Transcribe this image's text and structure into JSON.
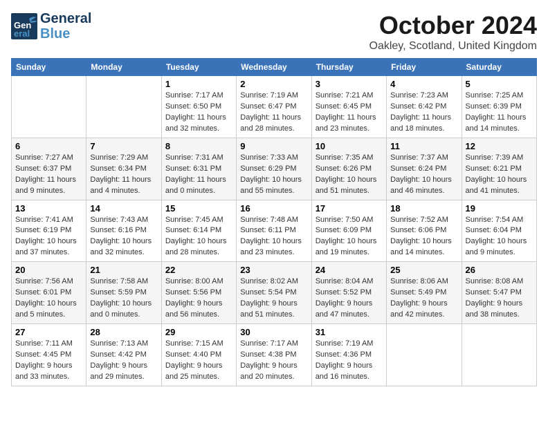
{
  "logo": {
    "line1": "General",
    "line2": "Blue"
  },
  "title": "October 2024",
  "subtitle": "Oakley, Scotland, United Kingdom",
  "days_of_week": [
    "Sunday",
    "Monday",
    "Tuesday",
    "Wednesday",
    "Thursday",
    "Friday",
    "Saturday"
  ],
  "weeks": [
    [
      {
        "day": "",
        "info": ""
      },
      {
        "day": "",
        "info": ""
      },
      {
        "day": "1",
        "info": "Sunrise: 7:17 AM\nSunset: 6:50 PM\nDaylight: 11 hours and 32 minutes."
      },
      {
        "day": "2",
        "info": "Sunrise: 7:19 AM\nSunset: 6:47 PM\nDaylight: 11 hours and 28 minutes."
      },
      {
        "day": "3",
        "info": "Sunrise: 7:21 AM\nSunset: 6:45 PM\nDaylight: 11 hours and 23 minutes."
      },
      {
        "day": "4",
        "info": "Sunrise: 7:23 AM\nSunset: 6:42 PM\nDaylight: 11 hours and 18 minutes."
      },
      {
        "day": "5",
        "info": "Sunrise: 7:25 AM\nSunset: 6:39 PM\nDaylight: 11 hours and 14 minutes."
      }
    ],
    [
      {
        "day": "6",
        "info": "Sunrise: 7:27 AM\nSunset: 6:37 PM\nDaylight: 11 hours and 9 minutes."
      },
      {
        "day": "7",
        "info": "Sunrise: 7:29 AM\nSunset: 6:34 PM\nDaylight: 11 hours and 4 minutes."
      },
      {
        "day": "8",
        "info": "Sunrise: 7:31 AM\nSunset: 6:31 PM\nDaylight: 11 hours and 0 minutes."
      },
      {
        "day": "9",
        "info": "Sunrise: 7:33 AM\nSunset: 6:29 PM\nDaylight: 10 hours and 55 minutes."
      },
      {
        "day": "10",
        "info": "Sunrise: 7:35 AM\nSunset: 6:26 PM\nDaylight: 10 hours and 51 minutes."
      },
      {
        "day": "11",
        "info": "Sunrise: 7:37 AM\nSunset: 6:24 PM\nDaylight: 10 hours and 46 minutes."
      },
      {
        "day": "12",
        "info": "Sunrise: 7:39 AM\nSunset: 6:21 PM\nDaylight: 10 hours and 41 minutes."
      }
    ],
    [
      {
        "day": "13",
        "info": "Sunrise: 7:41 AM\nSunset: 6:19 PM\nDaylight: 10 hours and 37 minutes."
      },
      {
        "day": "14",
        "info": "Sunrise: 7:43 AM\nSunset: 6:16 PM\nDaylight: 10 hours and 32 minutes."
      },
      {
        "day": "15",
        "info": "Sunrise: 7:45 AM\nSunset: 6:14 PM\nDaylight: 10 hours and 28 minutes."
      },
      {
        "day": "16",
        "info": "Sunrise: 7:48 AM\nSunset: 6:11 PM\nDaylight: 10 hours and 23 minutes."
      },
      {
        "day": "17",
        "info": "Sunrise: 7:50 AM\nSunset: 6:09 PM\nDaylight: 10 hours and 19 minutes."
      },
      {
        "day": "18",
        "info": "Sunrise: 7:52 AM\nSunset: 6:06 PM\nDaylight: 10 hours and 14 minutes."
      },
      {
        "day": "19",
        "info": "Sunrise: 7:54 AM\nSunset: 6:04 PM\nDaylight: 10 hours and 9 minutes."
      }
    ],
    [
      {
        "day": "20",
        "info": "Sunrise: 7:56 AM\nSunset: 6:01 PM\nDaylight: 10 hours and 5 minutes."
      },
      {
        "day": "21",
        "info": "Sunrise: 7:58 AM\nSunset: 5:59 PM\nDaylight: 10 hours and 0 minutes."
      },
      {
        "day": "22",
        "info": "Sunrise: 8:00 AM\nSunset: 5:56 PM\nDaylight: 9 hours and 56 minutes."
      },
      {
        "day": "23",
        "info": "Sunrise: 8:02 AM\nSunset: 5:54 PM\nDaylight: 9 hours and 51 minutes."
      },
      {
        "day": "24",
        "info": "Sunrise: 8:04 AM\nSunset: 5:52 PM\nDaylight: 9 hours and 47 minutes."
      },
      {
        "day": "25",
        "info": "Sunrise: 8:06 AM\nSunset: 5:49 PM\nDaylight: 9 hours and 42 minutes."
      },
      {
        "day": "26",
        "info": "Sunrise: 8:08 AM\nSunset: 5:47 PM\nDaylight: 9 hours and 38 minutes."
      }
    ],
    [
      {
        "day": "27",
        "info": "Sunrise: 7:11 AM\nSunset: 4:45 PM\nDaylight: 9 hours and 33 minutes."
      },
      {
        "day": "28",
        "info": "Sunrise: 7:13 AM\nSunset: 4:42 PM\nDaylight: 9 hours and 29 minutes."
      },
      {
        "day": "29",
        "info": "Sunrise: 7:15 AM\nSunset: 4:40 PM\nDaylight: 9 hours and 25 minutes."
      },
      {
        "day": "30",
        "info": "Sunrise: 7:17 AM\nSunset: 4:38 PM\nDaylight: 9 hours and 20 minutes."
      },
      {
        "day": "31",
        "info": "Sunrise: 7:19 AM\nSunset: 4:36 PM\nDaylight: 9 hours and 16 minutes."
      },
      {
        "day": "",
        "info": ""
      },
      {
        "day": "",
        "info": ""
      }
    ]
  ]
}
